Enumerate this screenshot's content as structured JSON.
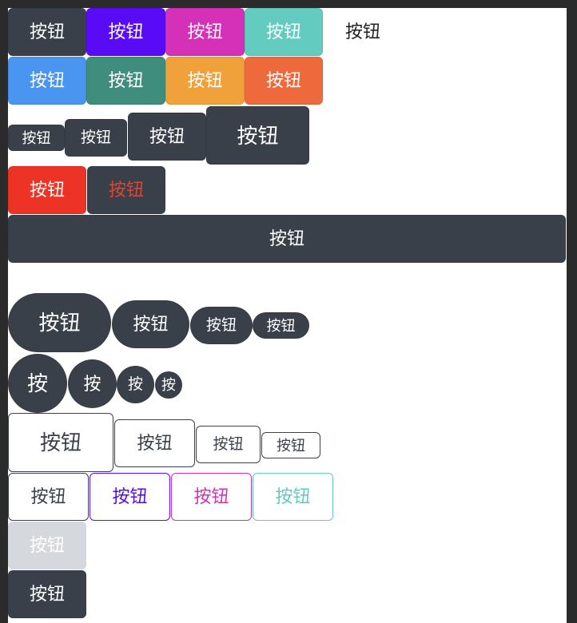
{
  "colors": {
    "dark": "#3a404a",
    "purple": "#5a0bf5",
    "pink": "#d531b8",
    "teal": "#63cbbf",
    "blue": "#4a95ef",
    "green": "#3f8d7d",
    "orange": "#f0a139",
    "orange_red": "#ee6a3c",
    "red": "#ec3325",
    "red_text": "#e2422f",
    "disabled_bg": "#d5d8dc"
  },
  "buttons": {
    "label": "按钮",
    "circle_label": "按"
  }
}
